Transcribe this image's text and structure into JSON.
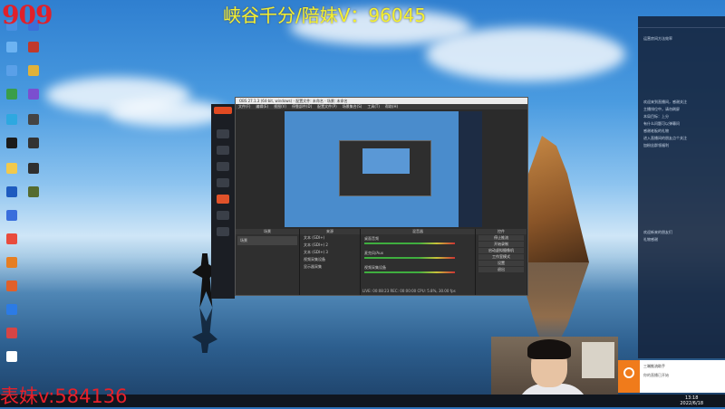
{
  "overlay": {
    "corner_title": "909",
    "top_banner": "峡谷千分/陪妹V：96045",
    "bottom_left": "表妹v:584136"
  },
  "obs": {
    "window_title": "OBS 27.1.3 (64-bit, windows) - 配置文件: 未命名 - 场景: 未命名",
    "menu": [
      "文件(F)",
      "编辑(E)",
      "视图(V)",
      "停靠部件(D)",
      "配置文件(P)",
      "场景集合(S)",
      "工具(T)",
      "帮助(H)"
    ],
    "scenes_header": "场景",
    "scene_item": "场景",
    "sources_header": "来源",
    "sources": [
      "文本 (GDI+)",
      "文本 (GDI+) 2",
      "文本 (GDI+) 3",
      "视频采集设备",
      "显示器采集"
    ],
    "mixer_header": "混音器",
    "mixer_tracks": [
      "桌面音频",
      "麦克风/Aux",
      "视频采集设备"
    ],
    "controls_header": "控件",
    "controls": [
      "停止推流",
      "开始录制",
      "启动虚拟摄像机",
      "工作室模式",
      "设置",
      "退出"
    ],
    "transitions_tab": "转场",
    "stats_tab": "场景转换",
    "status": "LIVE: 00:08:23   REC: 00:00:00   CPU: 5.8%, 30.00 fps"
  },
  "kk_sidebar": {
    "brand": "直播"
  },
  "right_panel": {
    "lines": [
      "运营房间方法效率",
      "欢迎来到直播间，感谢关注",
      "主播排位中，请勿刷屏",
      "本局目标：上分",
      "有什么问题可以弹幕问",
      "感谢老板的礼物",
      "进入直播间的朋友点个关注",
      "加粉丝群领福利",
      "欢迎新来的朋友们",
      "礼物感谢"
    ]
  },
  "notification": {
    "title": "三端推流助手",
    "body": "你的直播已开始"
  },
  "clock": {
    "time": "13:18",
    "date": "2022/6/18"
  }
}
